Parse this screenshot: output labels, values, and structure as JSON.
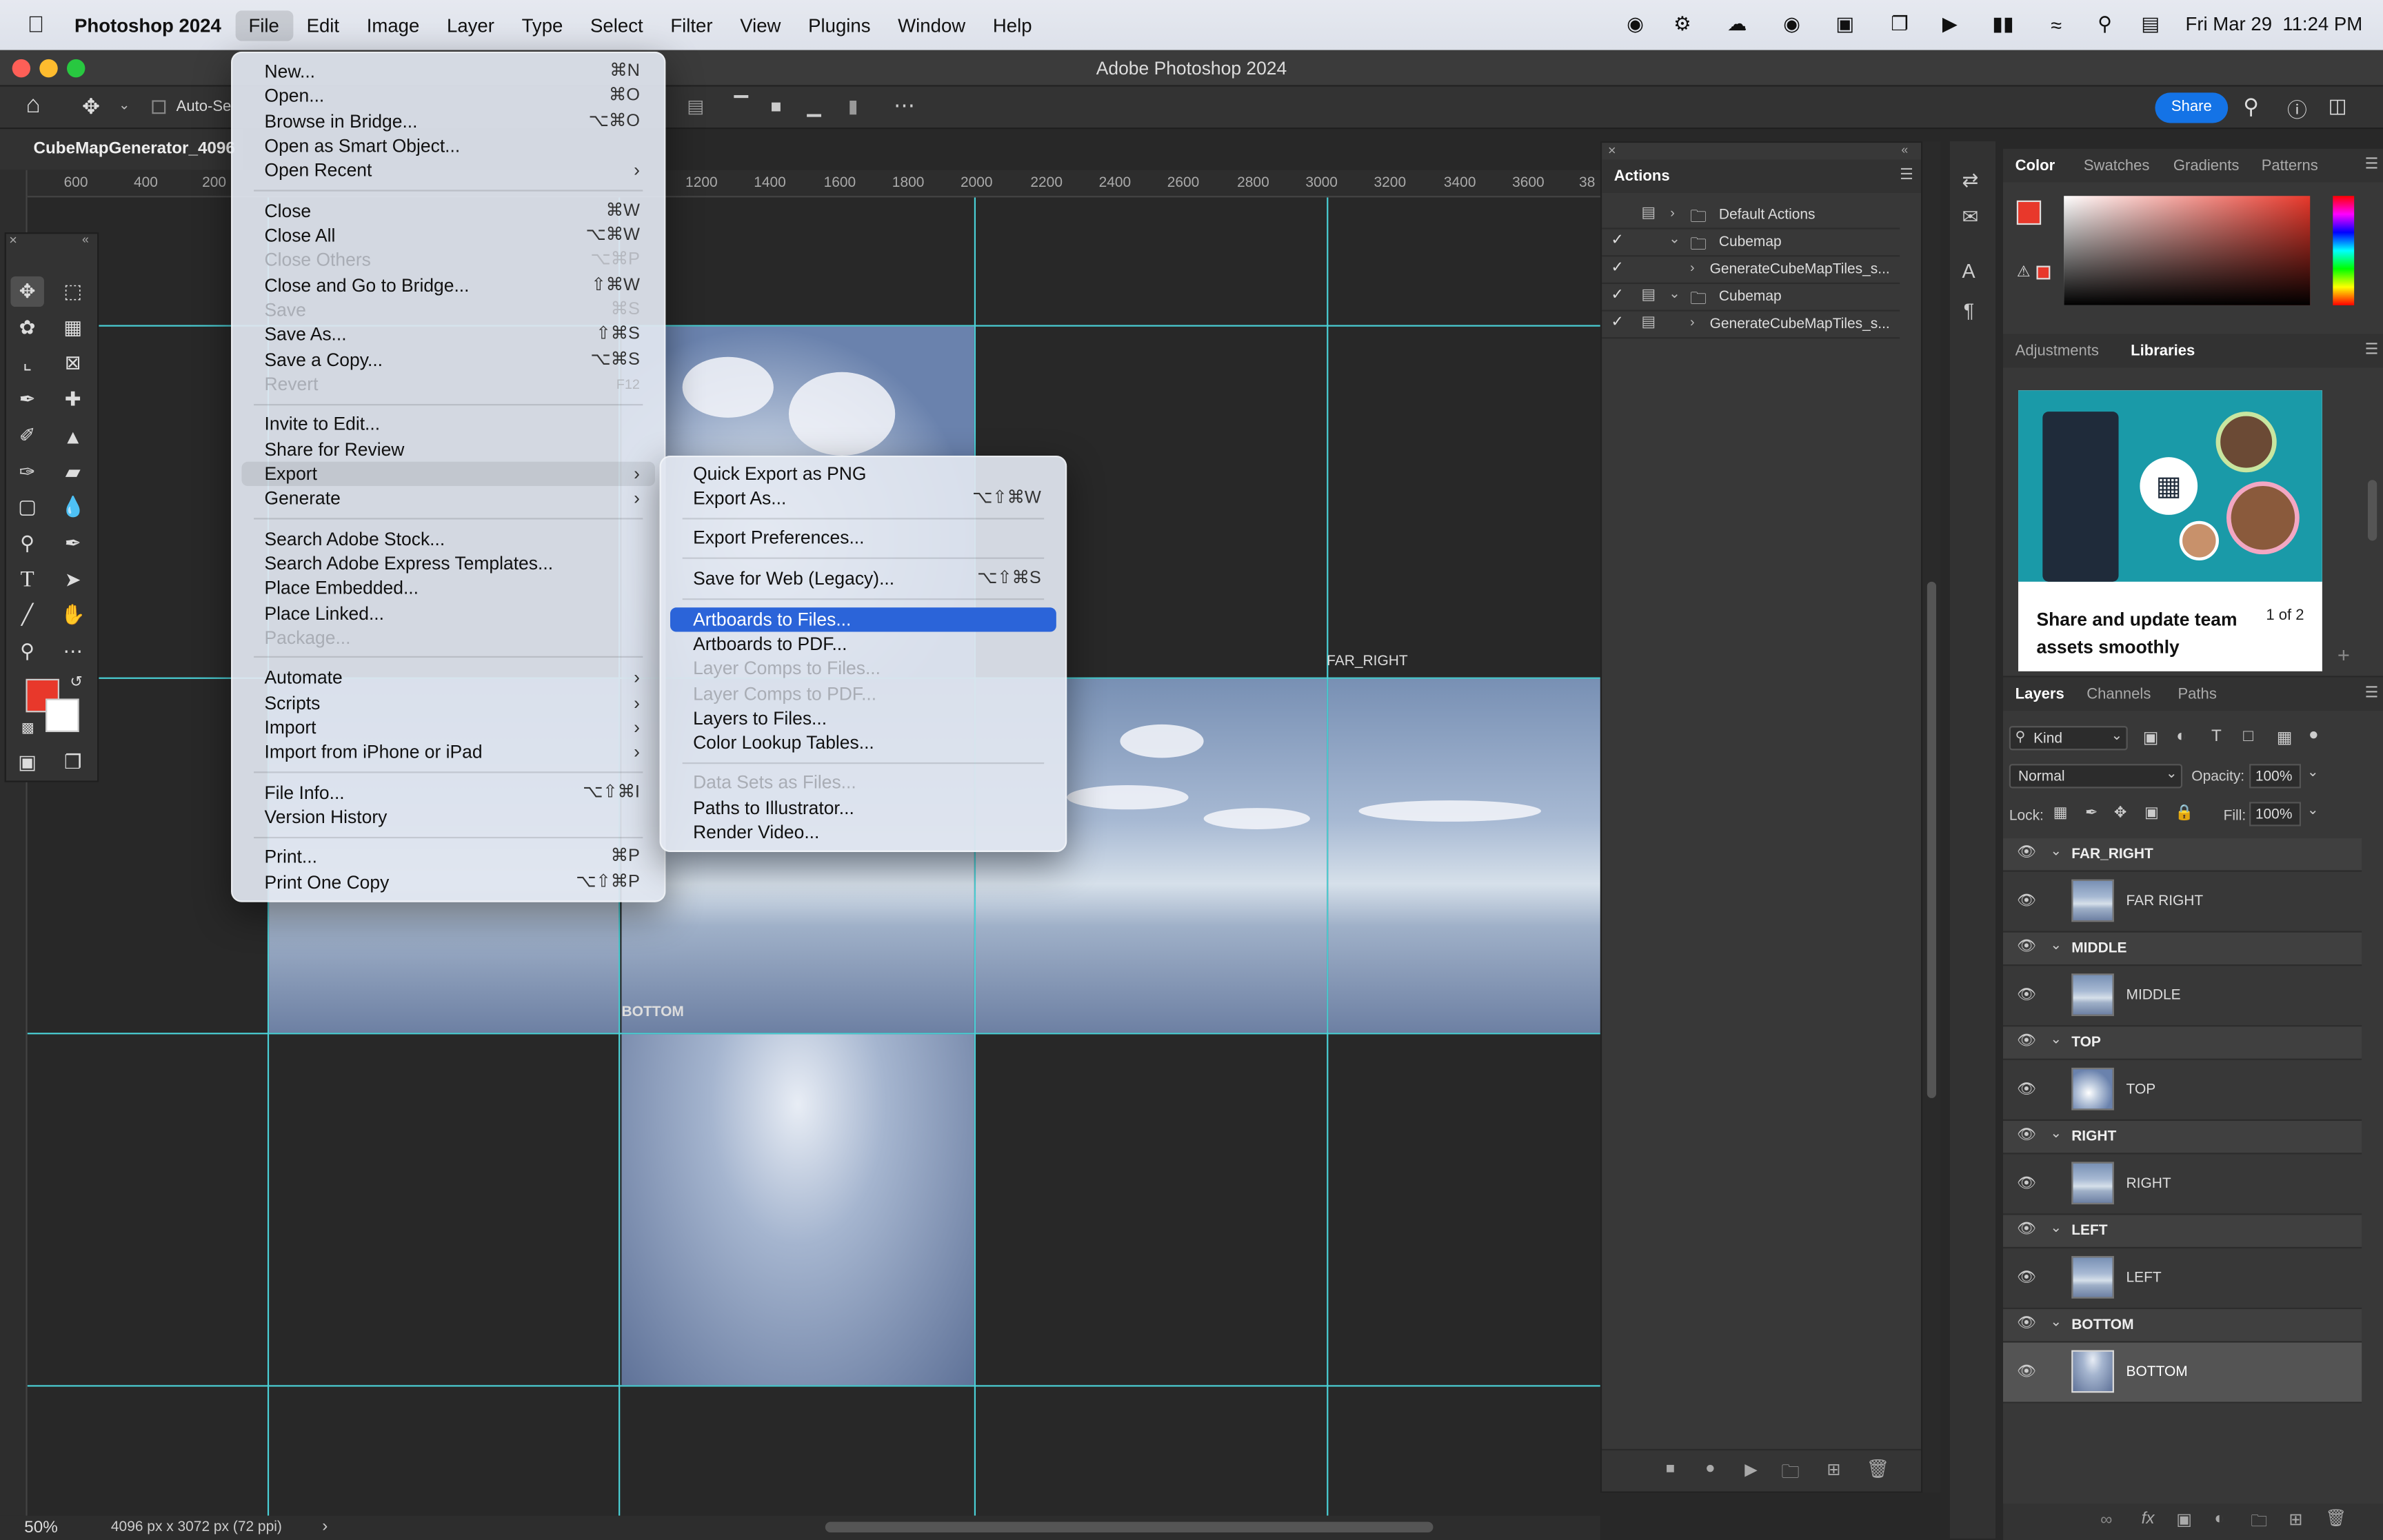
{
  "menubar": {
    "app": "Photoshop 2024",
    "items": [
      "File",
      "Edit",
      "Image",
      "Layer",
      "Type",
      "Select",
      "Filter",
      "View",
      "Plugins",
      "Window",
      "Help"
    ],
    "clock": "Fri Mar 29  11:24 PM"
  },
  "window": {
    "title": "Adobe Photoshop 2024"
  },
  "options_bar": {
    "auto_select": "Auto-Se",
    "share": "Share"
  },
  "document": {
    "tab": "CubeMapGenerator_4096",
    "zoom": "50%",
    "size": "4096 px x 3072 px (72 ppi)"
  },
  "ruler_ticks": [
    "600",
    "400",
    "200",
    "1200",
    "1400",
    "1600",
    "1800",
    "2000",
    "2200",
    "2400",
    "2600",
    "2800",
    "3000",
    "3200",
    "3400",
    "3600",
    "38"
  ],
  "artboards": {
    "far_right": "FAR_RIGHT",
    "bottom": "BOTTOM"
  },
  "file_menu": {
    "items": [
      {
        "label": "New...",
        "shortcut": "⌘N"
      },
      {
        "label": "Open...",
        "shortcut": "⌘O"
      },
      {
        "label": "Browse in Bridge...",
        "shortcut": "⌥⌘O"
      },
      {
        "label": "Open as Smart Object...",
        "shortcut": ""
      },
      {
        "label": "Open Recent",
        "shortcut": "",
        "submenu": true
      },
      {
        "label": "Close",
        "shortcut": "⌘W"
      },
      {
        "label": "Close All",
        "shortcut": "⌥⌘W"
      },
      {
        "label": "Close Others",
        "shortcut": "⌥⌘P",
        "disabled": true
      },
      {
        "label": "Close and Go to Bridge...",
        "shortcut": "⇧⌘W"
      },
      {
        "label": "Save",
        "shortcut": "⌘S",
        "disabled": true
      },
      {
        "label": "Save As...",
        "shortcut": "⇧⌘S"
      },
      {
        "label": "Save a Copy...",
        "shortcut": "⌥⌘S"
      },
      {
        "label": "Revert",
        "shortcut": "F12",
        "disabled": true
      },
      {
        "label": "Invite to Edit...",
        "shortcut": ""
      },
      {
        "label": "Share for Review",
        "shortcut": ""
      },
      {
        "label": "Export",
        "shortcut": "",
        "submenu": true,
        "highlight": true
      },
      {
        "label": "Generate",
        "shortcut": "",
        "submenu": true
      },
      {
        "label": "Search Adobe Stock...",
        "shortcut": ""
      },
      {
        "label": "Search Adobe Express Templates...",
        "shortcut": ""
      },
      {
        "label": "Place Embedded...",
        "shortcut": ""
      },
      {
        "label": "Place Linked...",
        "shortcut": ""
      },
      {
        "label": "Package...",
        "shortcut": "",
        "disabled": true
      },
      {
        "label": "Automate",
        "shortcut": "",
        "submenu": true
      },
      {
        "label": "Scripts",
        "shortcut": "",
        "submenu": true
      },
      {
        "label": "Import",
        "shortcut": "",
        "submenu": true
      },
      {
        "label": "Import from iPhone or iPad",
        "shortcut": "",
        "submenu": true
      },
      {
        "label": "File Info...",
        "shortcut": "⌥⇧⌘I"
      },
      {
        "label": "Version History",
        "shortcut": ""
      },
      {
        "label": "Print...",
        "shortcut": "⌘P"
      },
      {
        "label": "Print One Copy",
        "shortcut": "⌥⇧⌘P"
      }
    ]
  },
  "export_menu": {
    "items": [
      {
        "label": "Quick Export as PNG",
        "shortcut": ""
      },
      {
        "label": "Export As...",
        "shortcut": "⌥⇧⌘W"
      },
      {
        "label": "Export Preferences...",
        "shortcut": ""
      },
      {
        "label": "Save for Web (Legacy)...",
        "shortcut": "⌥⇧⌘S"
      },
      {
        "label": "Artboards to Files...",
        "shortcut": "",
        "selected": true
      },
      {
        "label": "Artboards to PDF...",
        "shortcut": ""
      },
      {
        "label": "Layer Comps to Files...",
        "shortcut": "",
        "disabled": true
      },
      {
        "label": "Layer Comps to PDF...",
        "shortcut": "",
        "disabled": true
      },
      {
        "label": "Layers to Files...",
        "shortcut": ""
      },
      {
        "label": "Color Lookup Tables...",
        "shortcut": ""
      },
      {
        "label": "Data Sets as Files...",
        "shortcut": "",
        "disabled": true
      },
      {
        "label": "Paths to Illustrator...",
        "shortcut": ""
      },
      {
        "label": "Render Video...",
        "shortcut": ""
      }
    ]
  },
  "actions_panel": {
    "title": "Actions",
    "rows": [
      "Default Actions",
      "Cubemap",
      "GenerateCubeMapTiles_s...",
      "Cubemap",
      "GenerateCubeMapTiles_s..."
    ]
  },
  "color_panel": {
    "tabs": [
      "Color",
      "Swatches",
      "Gradients",
      "Patterns"
    ],
    "foreground": "#e8382b",
    "background": "#ffffff"
  },
  "libraries_panel": {
    "tabs": [
      "Adjustments",
      "Libraries"
    ],
    "headline": "Share and update team assets smoothly",
    "pager": "1 of 2"
  },
  "layers_panel": {
    "tabs": [
      "Layers",
      "Channels",
      "Paths"
    ],
    "filter": "Kind",
    "blend_mode": "Normal",
    "opacity_label": "Opacity:",
    "opacity": "100%",
    "lock_label": "Lock:",
    "fill_label": "Fill:",
    "fill": "100%",
    "groups": [
      {
        "name": "FAR_RIGHT",
        "layer": "FAR RIGHT"
      },
      {
        "name": "MIDDLE",
        "layer": "MIDDLE"
      },
      {
        "name": "TOP",
        "layer": "TOP"
      },
      {
        "name": "RIGHT",
        "layer": "RIGHT"
      },
      {
        "name": "LEFT",
        "layer": "LEFT"
      },
      {
        "name": "BOTTOM",
        "layer": "BOTTOM"
      }
    ]
  },
  "colors": {
    "accent": "#2b64d9",
    "guide": "#4ad0d6",
    "share": "#1473e6"
  }
}
